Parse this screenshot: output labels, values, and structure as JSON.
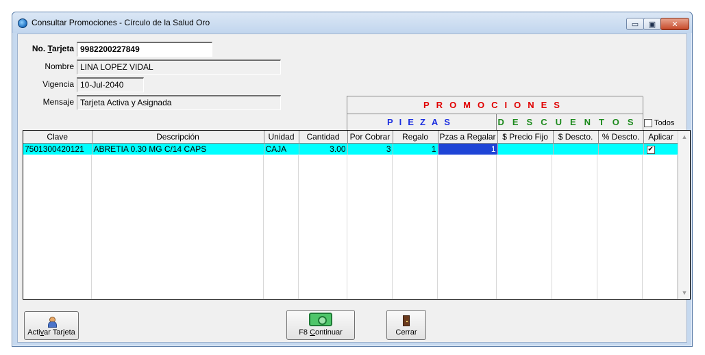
{
  "window": {
    "title": "Consultar Promociones - Círculo de la Salud Oro",
    "controls": {
      "minimize": "▭",
      "maximize": "▣",
      "close": "✕"
    }
  },
  "form": {
    "tarjeta": {
      "label_pre": "No. ",
      "label_u": "T",
      "label_post": "arjeta",
      "value": "9982200227849"
    },
    "nombre": {
      "label": "Nombre",
      "value": "LINA LOPEZ VIDAL"
    },
    "vigencia": {
      "label": "Vigencia",
      "value": "10-Jul-2040"
    },
    "mensaje": {
      "label": "Mensaje",
      "value": "Tarjeta Activa y Asignada"
    }
  },
  "promociones": {
    "title": "PROMOCIONES",
    "piezas": "PIEZAS",
    "descuentos": "DESCUENTOS",
    "todos_label": "Todos"
  },
  "grid": {
    "columns": [
      "Clave",
      "Descripción",
      "Unidad",
      "Cantidad",
      "Por Cobrar",
      "Regalo",
      "Pzas a Regalar",
      "$ Precio Fijo",
      "$ Descto.",
      "% Descto.",
      "Aplicar"
    ],
    "rows": [
      {
        "clave": "7501300420121",
        "descripcion": "ABRETIA 0.30 MG C/14 CAPS",
        "unidad": "CAJA",
        "cantidad": "3.00",
        "por_cobrar": "3",
        "regalo": "1",
        "pzas_regalar": "1",
        "precio_fijo": "",
        "descto": "",
        "pct_descto": "",
        "aplicar": "✔"
      }
    ],
    "scroll_up": "▲",
    "scroll_down": "▼"
  },
  "buttons": {
    "activar": {
      "pre": "Acti",
      "u": "v",
      "post": "ar Tarjeta"
    },
    "continuar": {
      "pre": "F8 ",
      "u": "C",
      "post": "ontinuar"
    },
    "cerrar": {
      "label": "Cerrar"
    }
  }
}
